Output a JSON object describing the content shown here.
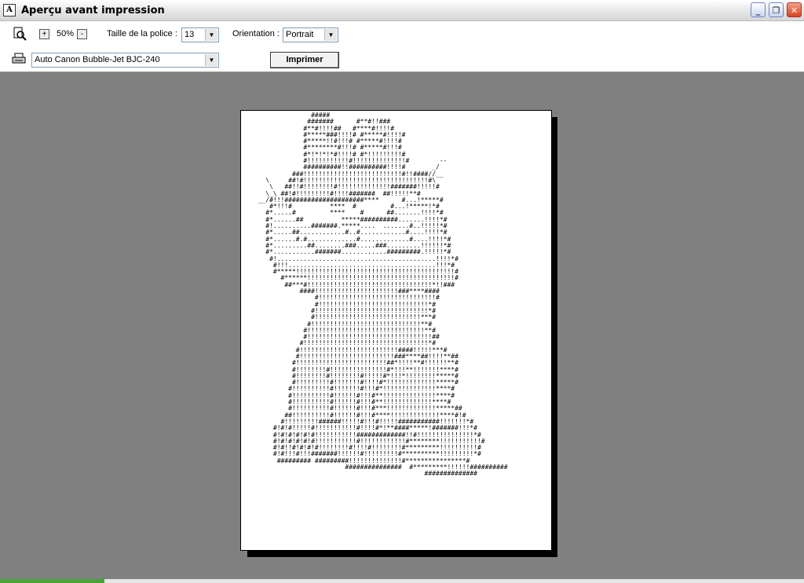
{
  "window": {
    "title": "Aperçu avant  impression",
    "app_icon_glyph": "A",
    "minimize_glyph": "_",
    "maximize_glyph": "❐",
    "close_glyph": "✕"
  },
  "toolbar": {
    "zoom_in_label": "+",
    "zoom_value": "50%",
    "zoom_out_label": "-",
    "font_size_label": "Taille de la police :",
    "font_size_value": "13",
    "orientation_label": "Orientation :",
    "orientation_value": "Portrait",
    "printer_value": "Auto Canon Bubble-Jet BJC-240",
    "print_button": "Imprimer"
  },
  "preview": {
    "ascii_art": "                #####\n               #######      #**#!!###\n              #**#!!!!##   #****#!!!!#\n              #*****###!!!!# #*****#!!!!#\n              #*****!!#!!!# #*****#!!!!#\n              #********#!!!# #*****#!!!#\n              #*!*!*!*#!!!!# #*!!!!!!!!!#\n              #!!!!!!!!!!!#!!!!!!!!!!!!!!#        --\n              ##########!!##########!!!!#       _/\n           ###!!!!!!!!!!!!!!!!!!!!!!!!!!#!!####//__\n    \\     ##!#!!!!!!!!!!!!!!!!!!!!!!!!!!!!!!!!!#\\\n     \\   ##!!#!!!!!!!!#!!!!!!!!!!!!!!#######!!!!!#\n    \\_\\ ##!#!!!!!!!!!#!!!!#######  ##!!!!!**#\n  __/#!!!#####################****      #...!*****#\n     #*!!!#          ****  #         #...!*****!*#\n    #*.....#         ****    #      ##.......!!!!*#\n    #*......##          *****##########.......!!!!*#\n    #!..........#######.*****....  .......#..!!!!!*#\n    #*.....##............#..#............#....!!!!*#\n    #*......#.#.............#.............#....!!!!*#\n    #*.........##........###.....###.........!!!!!!*#\n    #*...........#######............#########.!!!!!*#\n     #!..........................................!!!!*#\n      #!!!.......................................!!!*#\n      #*****!!!!!!!!!!!!!!!!!!!!!!!!!!!!!!!!!!!!!!!!!!#\n        #******!!!!!!!!!!!!!!!!!!!!!!!!!!!!!!!!!!!!!!!#\n         ##***#!!!!!!!!!!!!!!!!!!!!!!!!!!!!!!!!!*!!###\n             ####!!!!!!!!!!!!!!!!!!!!!!###****####\n                 #!!!!!!!!!!!!!!!!!!!!!!!!!!!!!!!#\n                 #!!!!!!!!!!!!!!!!!!!!!!!!!!!!!*#\n                #!!!!!!!!!!!!!!!!!!!!!!!!!!!!!!*#\n                #!!!!!!!!!!!!!!!!!!!!!!!!!!!!***#\n               #!!!!!!!!!!!!!!!!!!!!!!!!!!!!!**#\n              #!!!!!!!!!!!!!!!!!!!!!!!!!!!!!!!**#\n              #!!!!!!!!!!!!!!!!!!!!!!!!!!!!!!!!!##\n             #!!!!!!!!!!!!!!!!!!!!!!!!!!!!!!!!!*#\n            #!!!!!!!!!!!!!!!!!!!!!!!!!!####!!!!!***#\n            #!!!!!!!!!!!!!!!!!!!!!!!!!###****##!!!!**##\n           #!!!!!!!!!!!!!!!!!!!!!!!!##*!!!!**#!!!!!!**#\n           #!!!!!!!!#!!!!!!!!!!!!!!!#*!!!**!!!!!!!****#\n           #!!!!!!!!#!!!!!!!!#!!!!!#*!!!*!!!!!!!!*****#\n           #!!!!!!!!!#!!!!!!!#!!!!#*!!!!!!!!!!!!!*****#\n          #!!!!!!!!!!#!!!!!!!#!!!#*!!!!!!!!!!!!!!****#\n          #!!!!!!!!!!#!!!!!!#!!!#**!!!!!!!!!!!!!!****#\n          #!!!!!!!!!!#!!!!!!#!!!#**!!!!!!!!!!!!!****#\n          #!!!!!!!!!!#!!!!!!#!!!#***!!!!!!!!!!!!!*****##\n         ##!!!!!!!!!!#!!!!!!#!!!#****!!!!!!!!!!!!!****#!#\n        #!!!!!!!!!######!!!!!#!!!#!!!!!###########!!!!!!!*#\n      #!#!#!!!!!#!!!!!!!!!!!#!!!!#*!**####*****!#######!!!*#\n      #!#!#!#!#!#!!!!!!!!!!!#############!!#!!!!!!!!!!!!!!!*#\n      #!#!#!#!#!#!!!!!!!!!!!#!!!!!!!!!!!!#********!!!!!!!!!!!#\n      #!#!!#!#!#!#!!!!!!!!#!!!!#!!!!!!!!#*********!!!!!!!!!!#\n      #!#!!!#!!!#######!!!!!!#!!!!!!!!!#**********!!!!!!!!!*#\n       ######### #########!!!!!!!!!!!!!!#****************#\n                         ###############  #*********!!!!!!##########\n                                              ##############"
  },
  "colors": {
    "workspace": "#808080",
    "page": "#ffffff",
    "page_shadow": "#000000",
    "toolbar": "#ffffff"
  }
}
